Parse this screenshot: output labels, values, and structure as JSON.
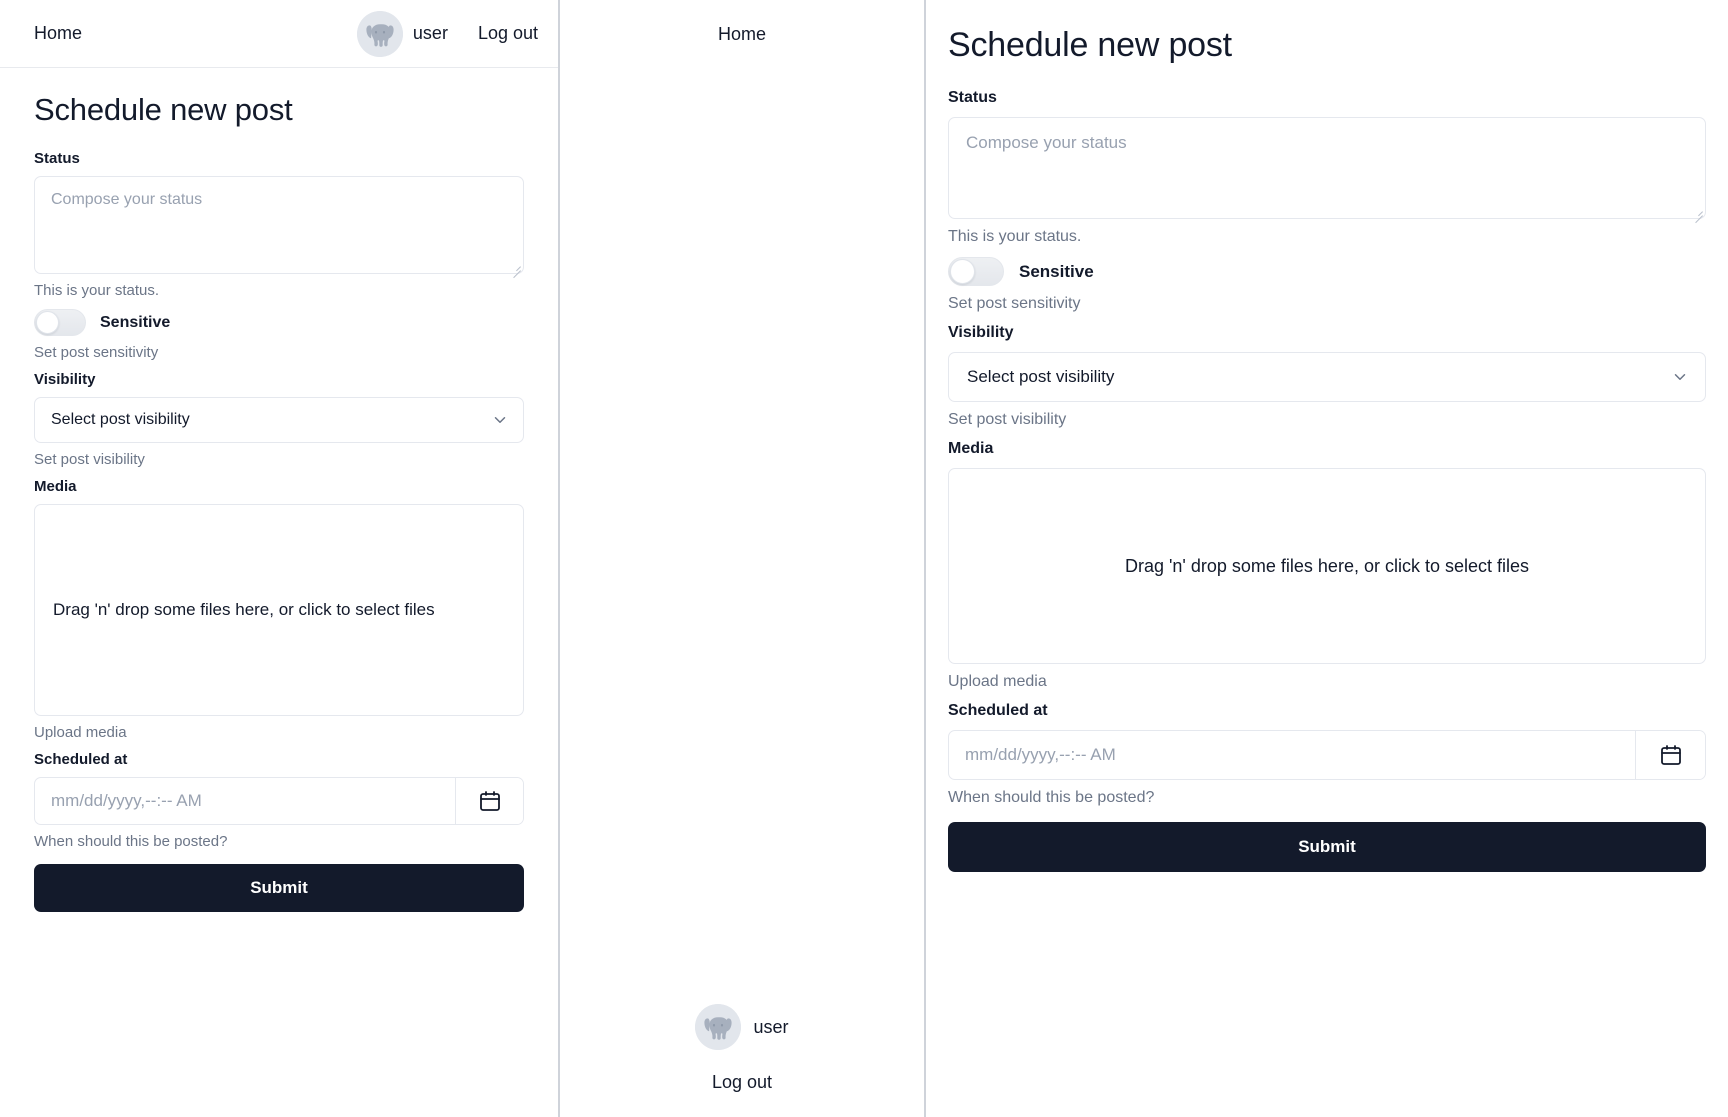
{
  "nav": {
    "home_label": "Home",
    "username": "user",
    "logout_label": "Log out",
    "avatar_icon": "elephant-avatar-icon"
  },
  "form": {
    "title": "Schedule new post",
    "status": {
      "label": "Status",
      "placeholder": "Compose your status",
      "value": "",
      "helper": "This is your status."
    },
    "sensitive": {
      "label": "Sensitive",
      "helper": "Set post sensitivity",
      "checked": false
    },
    "visibility": {
      "label": "Visibility",
      "selected": "Select post visibility",
      "helper": "Set post visibility",
      "chevron_icon": "chevron-down-icon"
    },
    "media": {
      "label": "Media",
      "dropzone_text": "Drag 'n' drop some files here, or click to select files",
      "helper": "Upload media"
    },
    "scheduled_at": {
      "label": "Scheduled at",
      "placeholder": "mm/dd/yyyy,--:-- AM",
      "value": "",
      "helper": "When should this be posted?",
      "calendar_icon": "calendar-icon"
    },
    "submit_label": "Submit"
  },
  "colors": {
    "text": "#131a2b",
    "muted": "#6b7587",
    "placeholder": "#98a1b0",
    "border": "#e5e8ee",
    "submit_bg": "#131a2b",
    "avatar_bg": "#e2e6ec",
    "panel_divider": "#cfd3da"
  }
}
